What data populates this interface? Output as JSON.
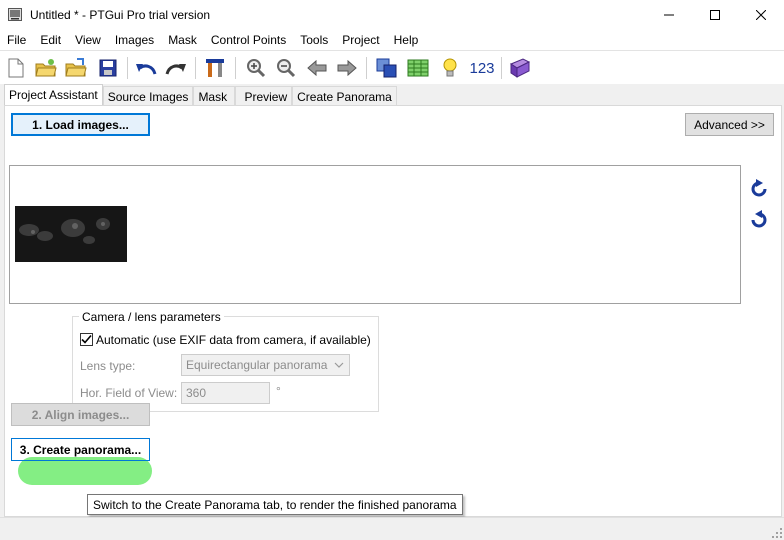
{
  "window": {
    "title": "Untitled * - PTGui Pro trial version",
    "minimize_icon": "minimize-icon",
    "maximize_icon": "maximize-icon",
    "close_icon": "close-icon"
  },
  "menu": [
    "File",
    "Edit",
    "View",
    "Images",
    "Mask",
    "Control Points",
    "Tools",
    "Project",
    "Help"
  ],
  "toolbar": {
    "items": [
      "new-file-icon",
      "open-folder-icon",
      "open-recent-icon",
      "save-icon",
      "undo-icon",
      "redo-icon",
      "tools-icon",
      "zoom-in-icon",
      "zoom-out-icon",
      "back-arrow-icon",
      "forward-arrow-icon",
      "panorama-editor-icon",
      "table-editor-icon",
      "lightbulb-icon",
      "numbers-icon",
      "help-book-icon"
    ],
    "numbers_label": "123"
  },
  "tabs": [
    {
      "label": "Project Assistant",
      "active": true
    },
    {
      "label": "Source Images",
      "active": false
    },
    {
      "label": "Mask",
      "active": false
    },
    {
      "label": "Preview",
      "active": false
    },
    {
      "label": "Create Panorama",
      "active": false
    }
  ],
  "assistant": {
    "load_button": "1. Load images...",
    "advanced_button": "Advanced >>",
    "rotate_left_icon": "rotate-left-icon",
    "rotate_right_icon": "rotate-right-icon",
    "camera_group": {
      "title": "Camera / lens parameters",
      "automatic_label": "Automatic (use EXIF data from camera, if available)",
      "automatic_checked": true,
      "lens_type_label": "Lens type:",
      "lens_type_value": "Equirectangular panorama",
      "fov_label": "Hor. Field of View:",
      "fov_value": "360",
      "fov_unit": "°"
    },
    "align_button": "2. Align images...",
    "create_button": "3. Create panorama...",
    "tooltip": "Switch to the Create Panorama tab, to render the finished panorama"
  },
  "colors": {
    "accent": "#0078d7",
    "highlight": "#6eeb6e",
    "icon_blue": "#1a3b9a"
  }
}
